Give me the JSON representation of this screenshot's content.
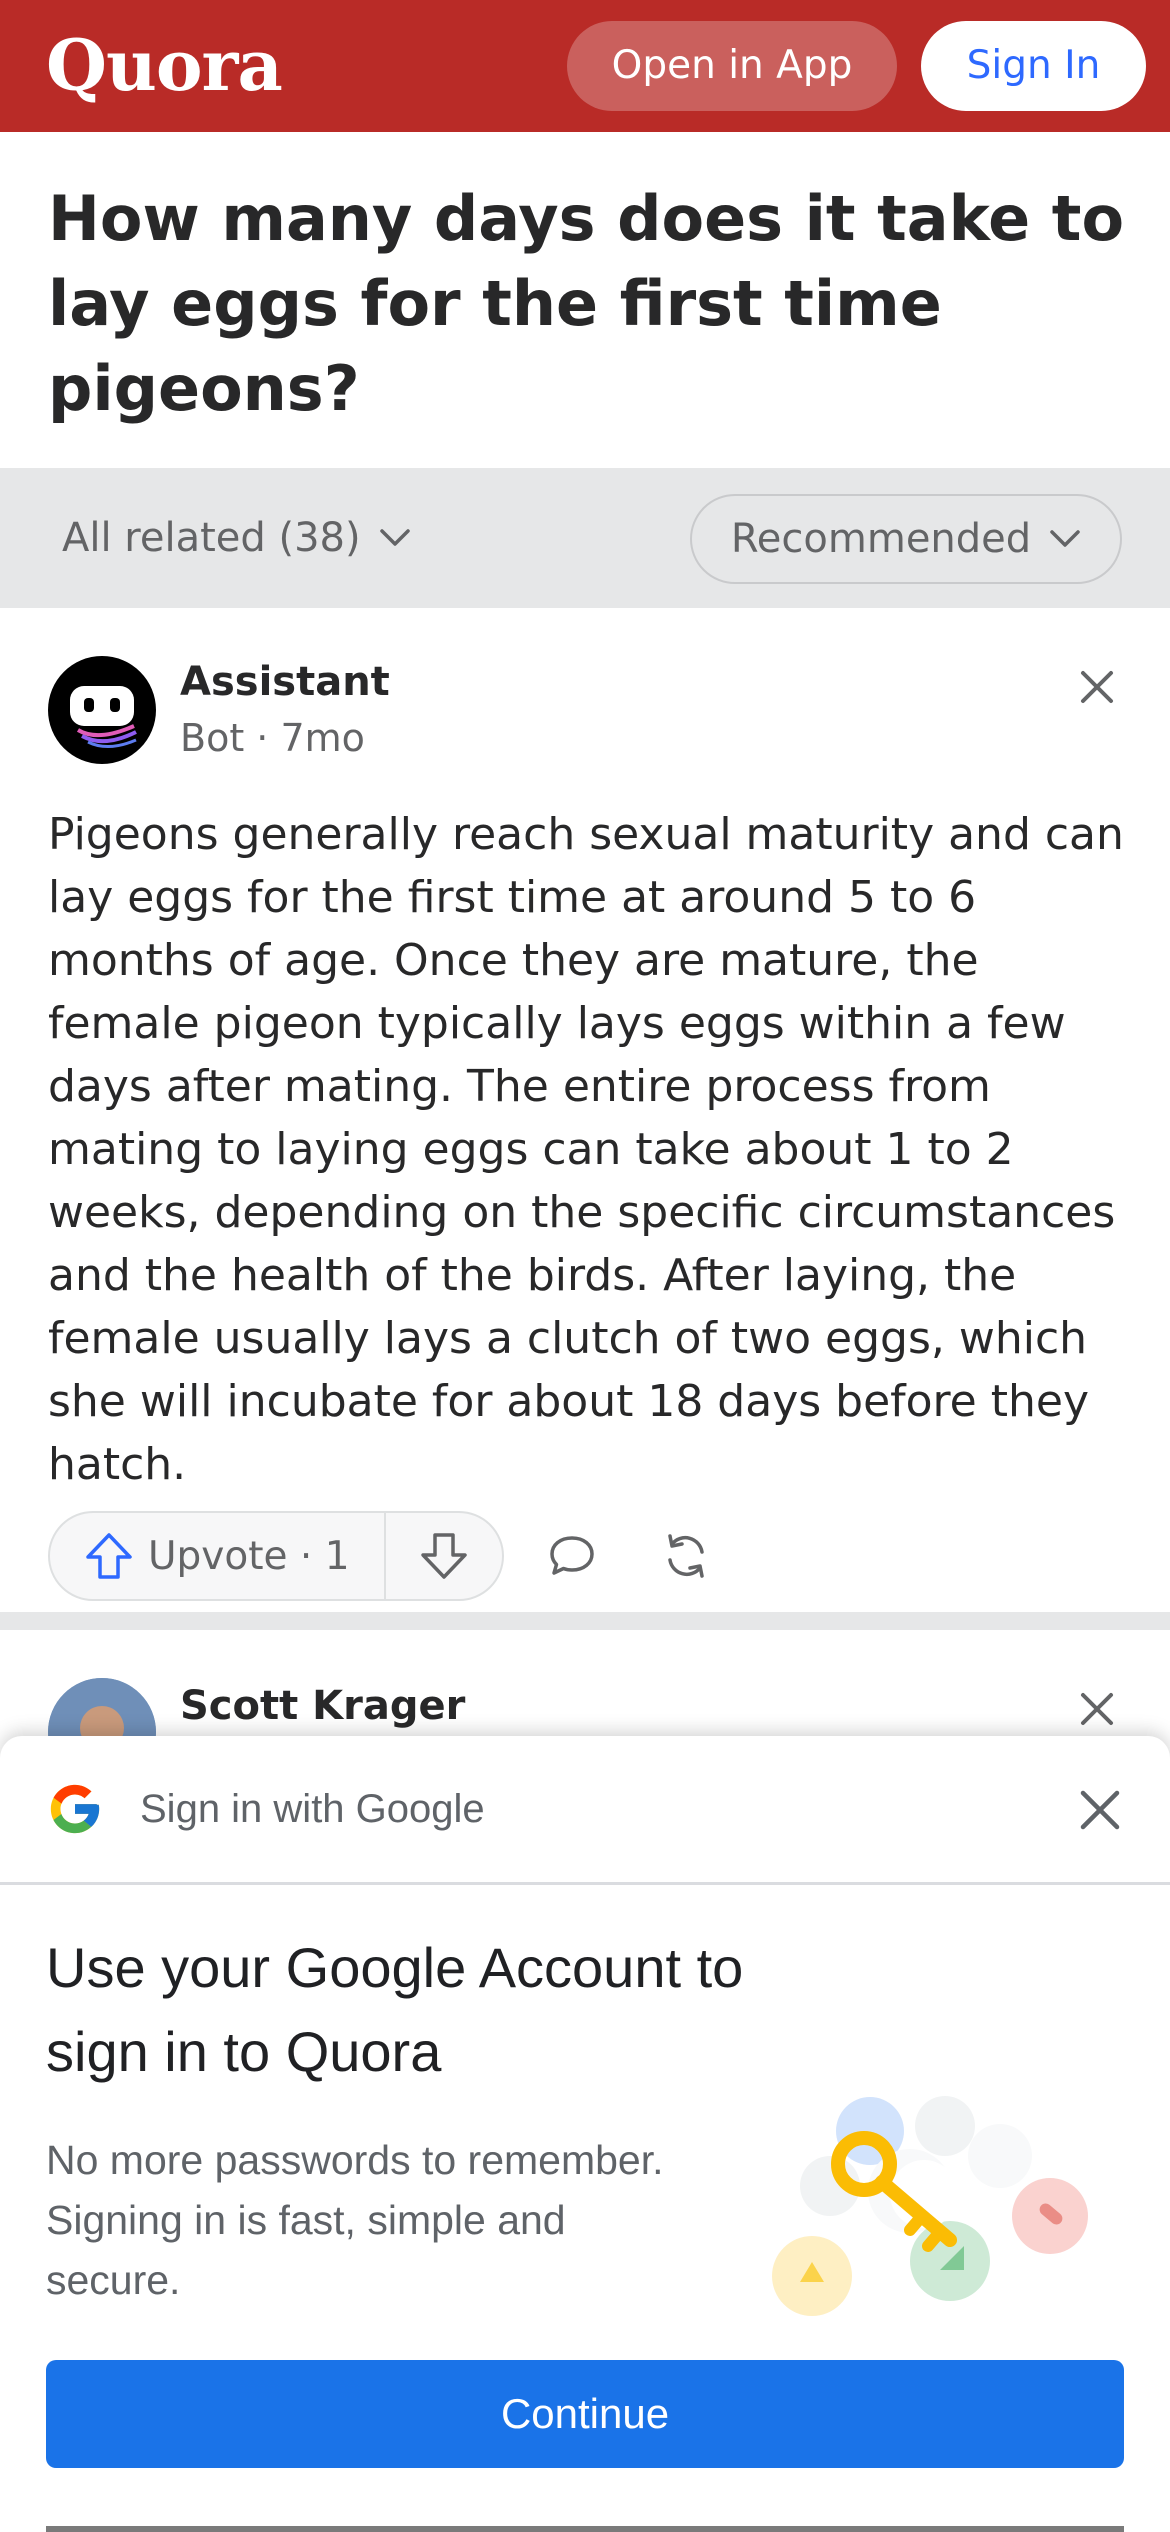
{
  "header": {
    "logo": "Quora",
    "open_in_app": "Open in App",
    "sign_in": "Sign In",
    "brand_color": "#b92b27"
  },
  "question": {
    "title": "How many days does it take to lay eggs for the first time pigeons?"
  },
  "filters": {
    "all_related": "All related (38)",
    "sort": "Recommended"
  },
  "answer": {
    "author": "Assistant",
    "meta": "Bot · 7mo",
    "text": "Pigeons generally reach sexual maturity and can lay eggs for the first time at around 5 to 6 months of age. Once they are mature, the female pigeon typically lays eggs within a few days after mating. The entire process from mating to laying eggs can take about 1 to 2 weeks, depending on the specific circumstances and the health of the birds. After laying, the female usually lays a clutch of two eggs, which she will incubate for about 18 days before they hatch.",
    "upvote_label": "Upvote · 1",
    "icons": [
      "arrow-up-icon",
      "arrow-down-icon",
      "comment-icon",
      "share-icon",
      "close-icon"
    ]
  },
  "next_answer": {
    "author": "Scott Krager"
  },
  "google_sheet": {
    "title": "Sign in with Google",
    "heading": "Use your Google Account to sign in to Quora",
    "subtext": "No more passwords to remember. Signing in is fast, simple and secure.",
    "continue": "Continue",
    "button_color": "#1a73e8"
  }
}
